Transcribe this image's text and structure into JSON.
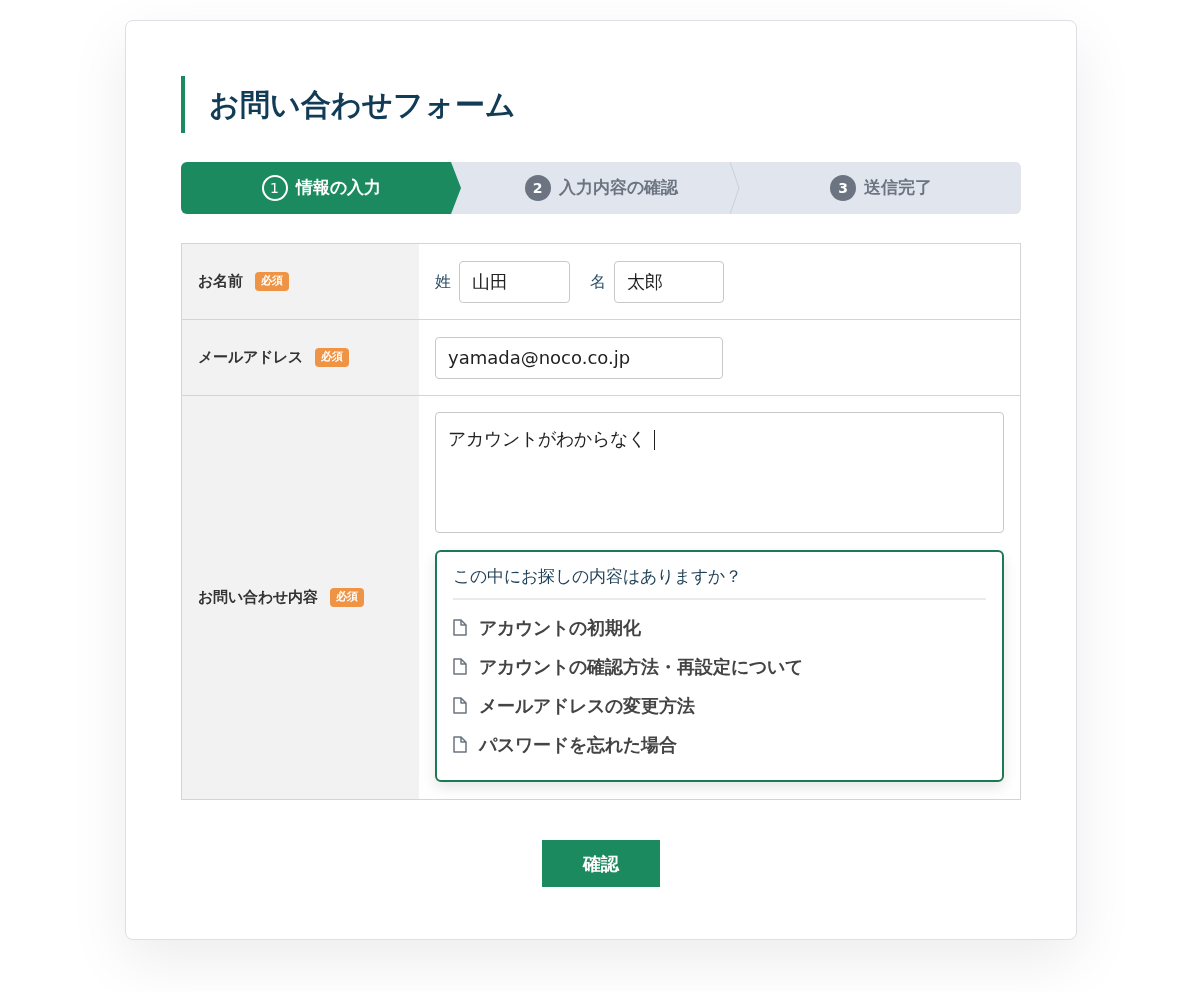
{
  "title": "お問い合わせフォーム",
  "steps": [
    {
      "number": "1",
      "label": "情報の入力",
      "active": true
    },
    {
      "number": "2",
      "label": "入力内容の確認",
      "active": false
    },
    {
      "number": "3",
      "label": "送信完了",
      "active": false
    }
  ],
  "name_row": {
    "label": "お名前",
    "badge": "必須",
    "last_label": "姓",
    "last_value": "山田",
    "first_label": "名",
    "first_value": "太郎"
  },
  "email_row": {
    "label": "メールアドレス",
    "badge": "必須",
    "value": "yamada@noco.co.jp"
  },
  "message_row": {
    "label": "お問い合わせ内容",
    "badge": "必須",
    "value": "アカウントがわからなく"
  },
  "suggestions": {
    "heading": "この中にお探しの内容はありますか？",
    "items": [
      {
        "label": "アカウントの初期化"
      },
      {
        "label": "アカウントの確認方法・再設定について"
      },
      {
        "label": "メールアドレスの変更方法"
      },
      {
        "label": "パスワードを忘れた場合"
      }
    ]
  },
  "submit_button": "確認"
}
